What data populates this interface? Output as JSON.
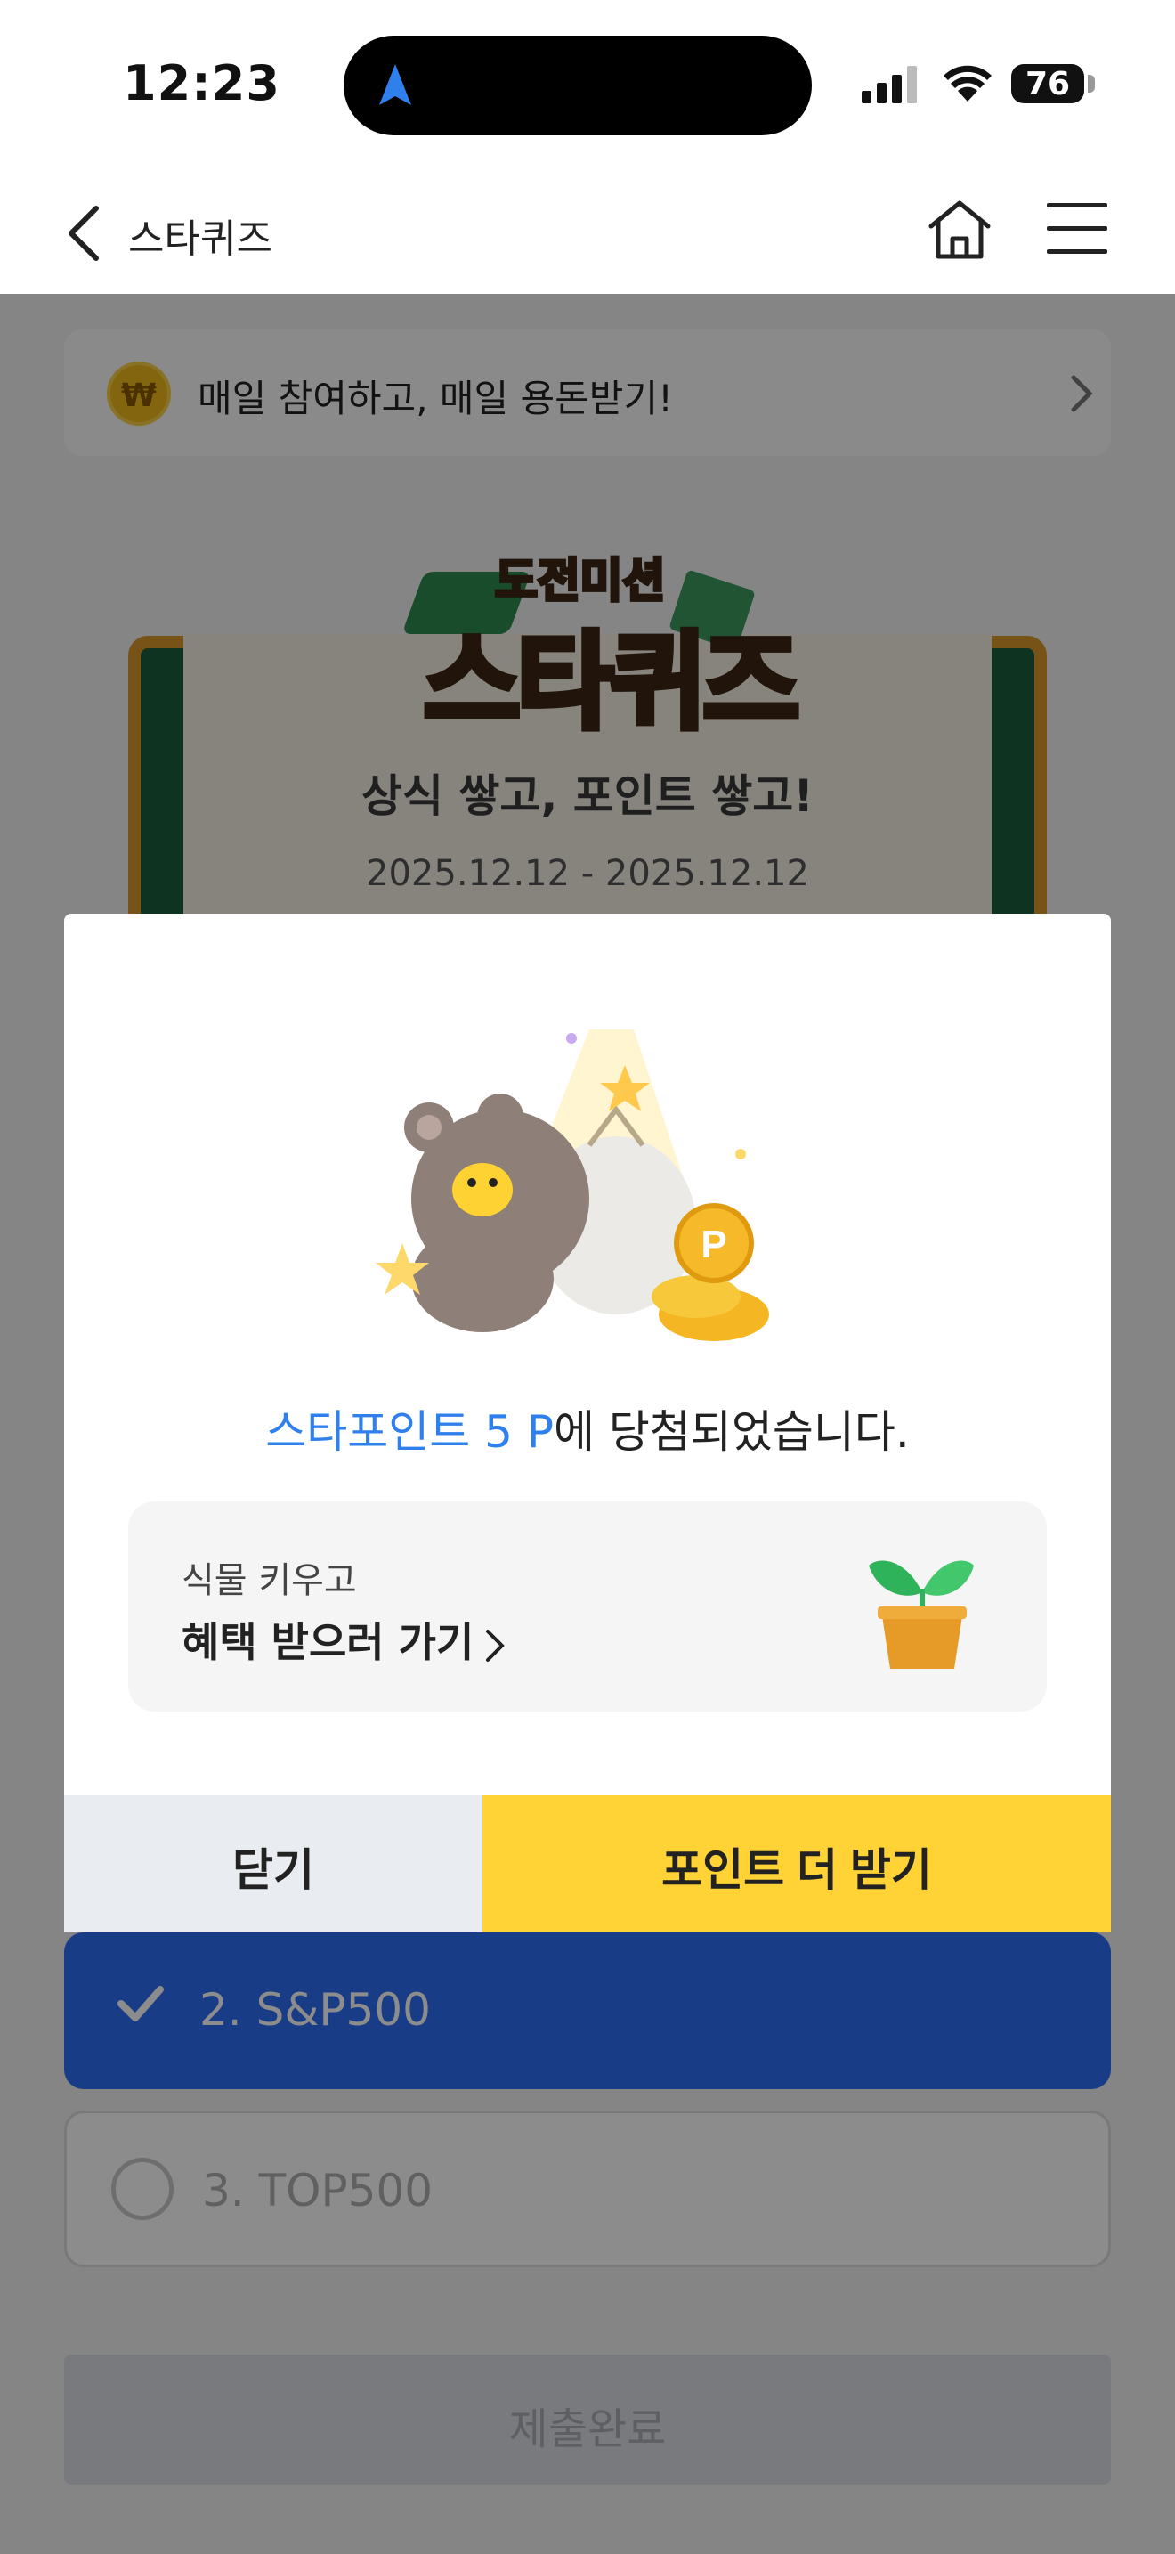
{
  "status_bar": {
    "time": "12:23",
    "battery": "76"
  },
  "nav": {
    "title": "스타퀴즈"
  },
  "banner": {
    "coin_symbol": "₩",
    "text": "매일 참여하고, 매일 용돈받기!"
  },
  "quiz_board": {
    "logo_top": "도전미션",
    "logo_main": "스타퀴즈",
    "subtitle": "상식 쌓고, 포인트 쌓고!",
    "date_range": "2025.12.12 - 2025.12.12"
  },
  "options": [
    {
      "label": "2. S&P500",
      "selected": true
    },
    {
      "label": "3. TOP500",
      "selected": false
    }
  ],
  "submit": {
    "label": "제출완료"
  },
  "modal": {
    "coin_letter": "P",
    "result_highlight": "스타포인트 5 P",
    "result_rest": "에 당첨되었습니다.",
    "plant_card": {
      "subtitle": "식물 키우고",
      "link_label": "혜택 받으러 가기"
    },
    "close_label": "닫기",
    "more_points_label": "포인트 더 받기"
  },
  "colors": {
    "accent_blue": "#2f80ed",
    "primary_yellow": "#ffd335",
    "selected_option": "#2e6df5"
  }
}
